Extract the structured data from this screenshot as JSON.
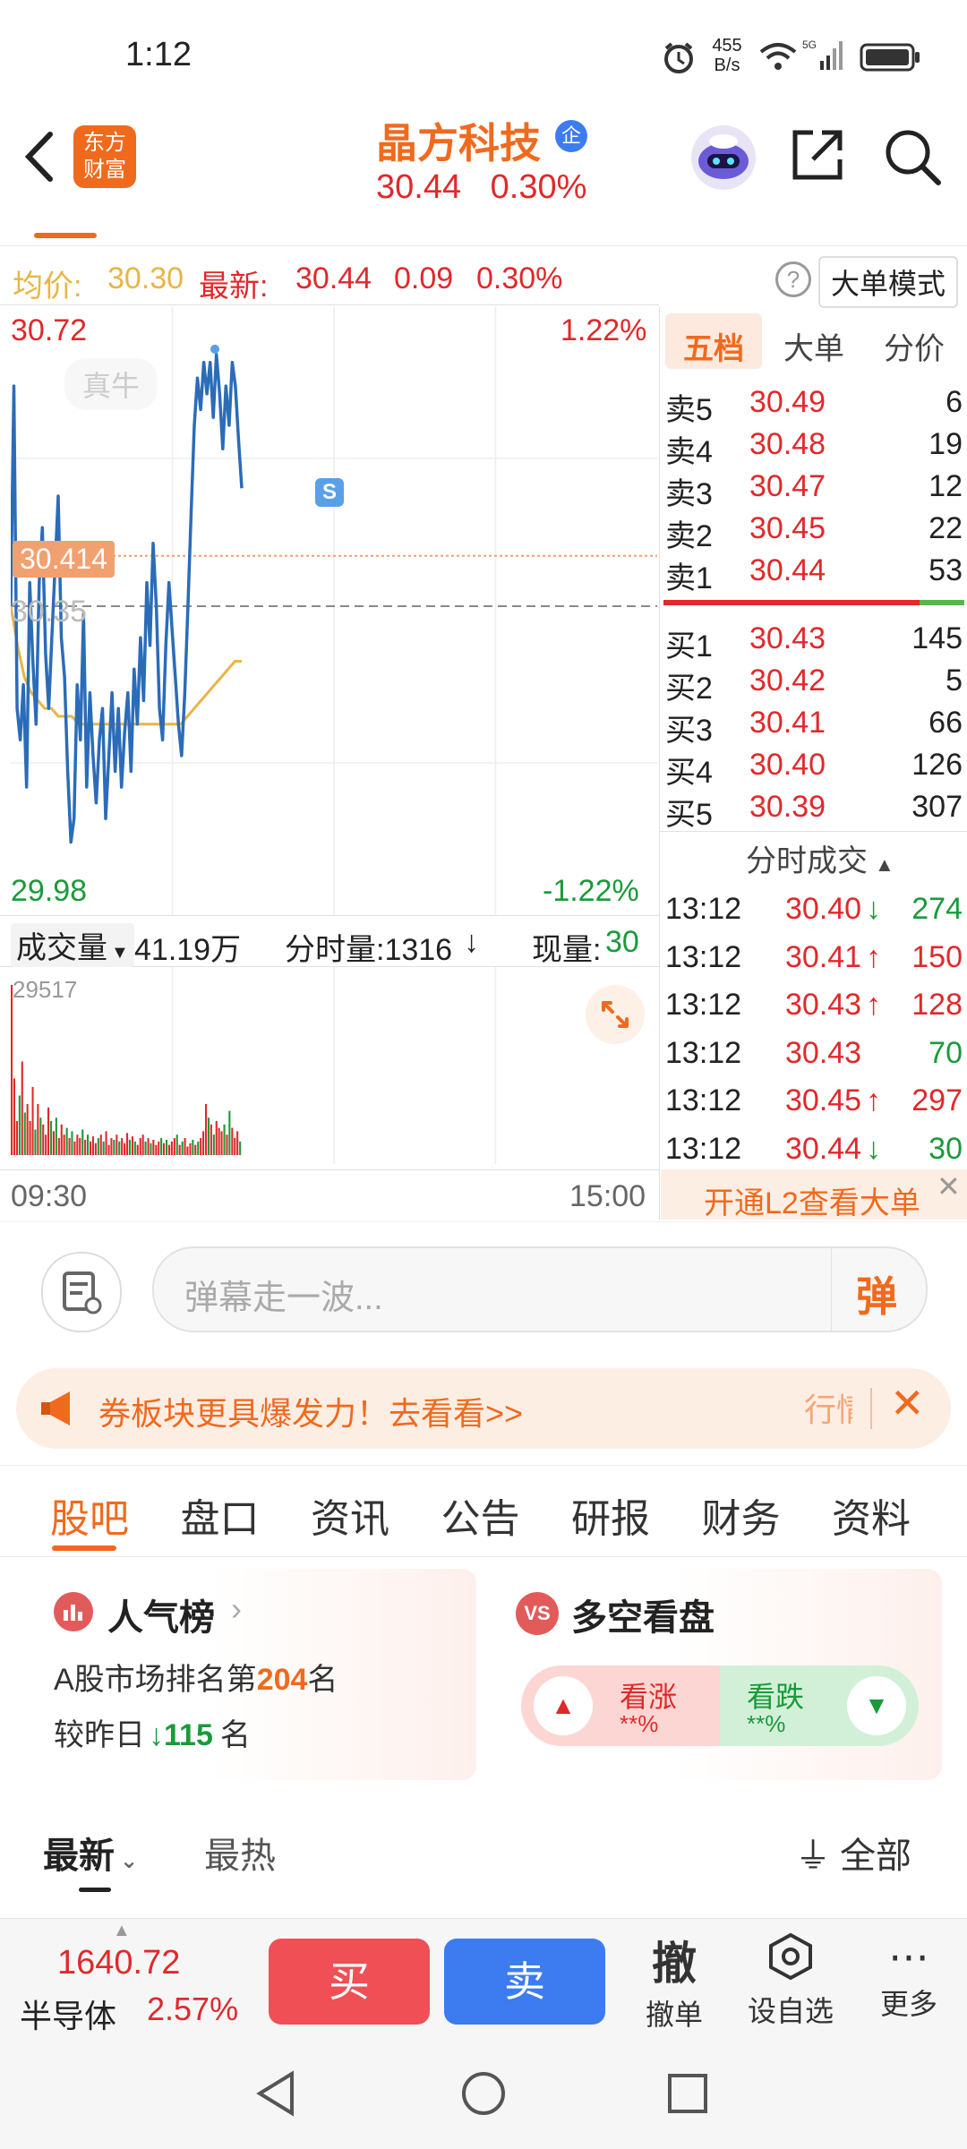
{
  "status_bar": {
    "time": "1:12",
    "net_speed_top": "455",
    "net_speed_bottom": "B/s"
  },
  "header": {
    "logo_line1": "东方",
    "logo_line2": "财富",
    "stock_name": "晶方科技",
    "badge": "企",
    "price": "30.44",
    "change_pct": "0.30%"
  },
  "avg_row": {
    "avg_label": "均价:",
    "avg_value": "30.30",
    "latest_label": "最新:",
    "latest_value": "30.44",
    "change": "0.09",
    "change_pct": "0.30%",
    "mode_button": "大单模式"
  },
  "chart_data": {
    "type": "line",
    "y_max_label": "30.72",
    "y_min_label": "29.98",
    "pct_max_label": "1.22%",
    "pct_min_label": "-1.22%",
    "ylim": [
      29.98,
      30.72
    ],
    "prev_close": "30.35",
    "crosshair_price": "30.414",
    "watermark": "真牛",
    "signal_marker": "S",
    "x_start_label": "09:30",
    "x_end_label": "15:00",
    "series": [
      {
        "values": [
          30.35,
          30.63,
          30.22,
          30.18,
          30.25,
          30.12,
          30.38,
          30.28,
          30.2,
          30.38,
          30.45,
          30.29,
          30.22,
          30.31,
          30.4,
          30.49,
          30.31,
          30.26,
          30.14,
          30.05,
          30.08,
          30.25,
          30.18,
          30.34,
          30.12,
          30.24,
          30.16,
          30.1,
          30.18,
          30.22,
          30.08,
          30.16,
          30.24,
          30.14,
          30.22,
          30.12,
          30.19,
          30.24,
          30.14,
          30.27,
          30.2,
          30.31,
          30.23,
          30.38,
          30.3,
          30.43,
          30.35,
          30.22,
          30.18,
          30.3,
          30.38,
          30.32,
          30.26,
          30.2,
          30.16,
          30.24,
          30.35,
          30.47,
          30.58,
          30.64,
          30.6,
          30.66,
          30.62,
          30.66,
          30.59,
          30.67,
          30.62,
          30.55,
          30.63,
          30.58,
          30.66,
          30.63,
          30.56,
          30.5
        ]
      },
      {
        "values": [
          30.35,
          30.3,
          30.26,
          30.24,
          30.23,
          30.22,
          30.22,
          30.21,
          30.21,
          30.21,
          30.2,
          30.2,
          30.2,
          30.2,
          30.2,
          30.2,
          30.2,
          30.2,
          30.2,
          30.2,
          30.2,
          30.2,
          30.2,
          30.2,
          30.2,
          30.2,
          30.21,
          30.22,
          30.23,
          30.24,
          30.25,
          30.26,
          30.27,
          30.28,
          30.28
        ]
      }
    ]
  },
  "volume": {
    "selector_label": "成交量",
    "total": "41.19万",
    "tick_vol_label": "分时量:1316",
    "tick_arrow": "↓",
    "current_label": "现量:",
    "current_value": "30",
    "max_label": "29517"
  },
  "order_book": {
    "tabs": [
      "五档",
      "大单",
      "分价"
    ],
    "asks": [
      {
        "label": "卖5",
        "price": "30.49",
        "vol": "6"
      },
      {
        "label": "卖4",
        "price": "30.48",
        "vol": "19"
      },
      {
        "label": "卖3",
        "price": "30.47",
        "vol": "12"
      },
      {
        "label": "卖2",
        "price": "30.45",
        "vol": "22"
      },
      {
        "label": "卖1",
        "price": "30.44",
        "vol": "53"
      }
    ],
    "bids": [
      {
        "label": "买1",
        "price": "30.43",
        "vol": "145"
      },
      {
        "label": "买2",
        "price": "30.42",
        "vol": "5"
      },
      {
        "label": "买3",
        "price": "30.41",
        "vol": "66"
      },
      {
        "label": "买4",
        "price": "30.40",
        "vol": "126"
      },
      {
        "label": "买5",
        "price": "30.39",
        "vol": "307"
      }
    ],
    "trades_title": "分时成交",
    "trades": [
      {
        "time": "13:12",
        "price": "30.40",
        "arrow": "↓",
        "vol": "274",
        "color": "#1a9a3a"
      },
      {
        "time": "13:12",
        "price": "30.41",
        "arrow": "↑",
        "vol": "150",
        "color": "#e0292b"
      },
      {
        "time": "13:12",
        "price": "30.43",
        "arrow": "↑",
        "vol": "128",
        "color": "#e0292b"
      },
      {
        "time": "13:12",
        "price": "30.43",
        "arrow": "",
        "vol": "70",
        "color": "#1a9a3a"
      },
      {
        "time": "13:12",
        "price": "30.45",
        "arrow": "↑",
        "vol": "297",
        "color": "#e0292b"
      },
      {
        "time": "13:12",
        "price": "30.44",
        "arrow": "↓",
        "vol": "30",
        "color": "#1a9a3a"
      }
    ],
    "l2_promo": "开通L2查看大单"
  },
  "danmaku": {
    "placeholder": "弹幕走一波...",
    "send_label": "弹"
  },
  "banner": {
    "text": "券板块更具爆发力！去看看>>",
    "right_text": "行情"
  },
  "section_tabs": [
    "股吧",
    "盘口",
    "资讯",
    "公告",
    "研报",
    "财务",
    "资料"
  ],
  "popularity": {
    "title": "人气榜",
    "line1_prefix": "A股市场排名第",
    "rank": "204",
    "line1_suffix": "名",
    "line2_prefix": "较昨日",
    "change": "115",
    "line2_suffix": "名"
  },
  "bull_bear": {
    "title": "多空看盘",
    "bull_label": "看涨",
    "bull_value": "**%",
    "bear_label": "看跌",
    "bear_value": "**%"
  },
  "feed_filters": {
    "latest": "最新",
    "hot": "最热",
    "all": "全部"
  },
  "bottom_bar": {
    "index_value": "1640.72",
    "index_name": "半导体",
    "index_pct": "2.57%",
    "buy": "买",
    "sell": "卖",
    "cancel_char": "撤",
    "cancel_label": "撤单",
    "watch_label": "设自选",
    "more_label": "更多"
  },
  "colors": {
    "up": "#e0292b",
    "down": "#1a9a3a",
    "brand": "#f06a1e",
    "price_line": "#2b6cb8",
    "avg_line": "#e8b545"
  }
}
